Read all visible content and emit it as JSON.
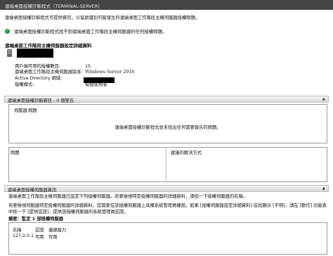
{
  "window": {
    "title": "遠端桌面授權診斷程式（TERMINAL-SERVER）"
  },
  "top_description": "遠端桌面授權診斷程式可提供資訊，以協助識別可能發生的遠端桌面工作階段主機伺服器授權問題。",
  "status": {
    "icon": "check-circle-icon",
    "text": "遠端桌面授權診斷程式找不到遠端桌面工作階段主機伺服器的任何授權問題。"
  },
  "server_section": {
    "heading": "遠端桌面工作階段主機伺服器設定詳細資料",
    "fields": [
      {
        "label": "用戶端可用的授權數目:",
        "value": "15"
      },
      {
        "label": "遠端桌面工作階段主機伺服器版本:",
        "value": "Windows Server 2016"
      },
      {
        "label": "Active Directory 網域:",
        "value": ""
      },
      {
        "label": "授權模式:",
        "value": "每個使用者"
      }
    ]
  },
  "diagnostics_panel": {
    "header": "遠端桌面授權診斷資訊 - 0 個警告",
    "columns": [
      "伺服器",
      "問題"
    ],
    "empty_message": "遠端桌面授權診斷程式並未找出任何需要報告的問題。",
    "issue_label": "問題",
    "resolution_label": "建議的解決方式"
  },
  "license_panel": {
    "header": "遠端桌面授權伺服器資訊",
    "description_line1": "遠端桌面工作階段主機伺服器已設定下列授權伺服器。若要檢視特定授權伺服器的詳細資料，請按一下授權伺服器的名稱。",
    "description_line2": "若要檢視伺服器特定授權伺服器的詳細資料，您需要在該授權伺服器上具備系統管理員權限。如果 [授權伺服器設定詳細資料] 區段顯示 [不明]，請在 [動作] 功能表中按一下 [提供認證]，提供該授權伺服器的系統管理員認證。",
    "summary_heading": "摘要：監定 1 部授權伺服器",
    "table": {
      "headers": [
        "名稱",
        "認證",
        "連線能力"
      ],
      "rows": [
        [
          "127.0.0.1",
          "可用",
          "可用"
        ]
      ]
    }
  }
}
